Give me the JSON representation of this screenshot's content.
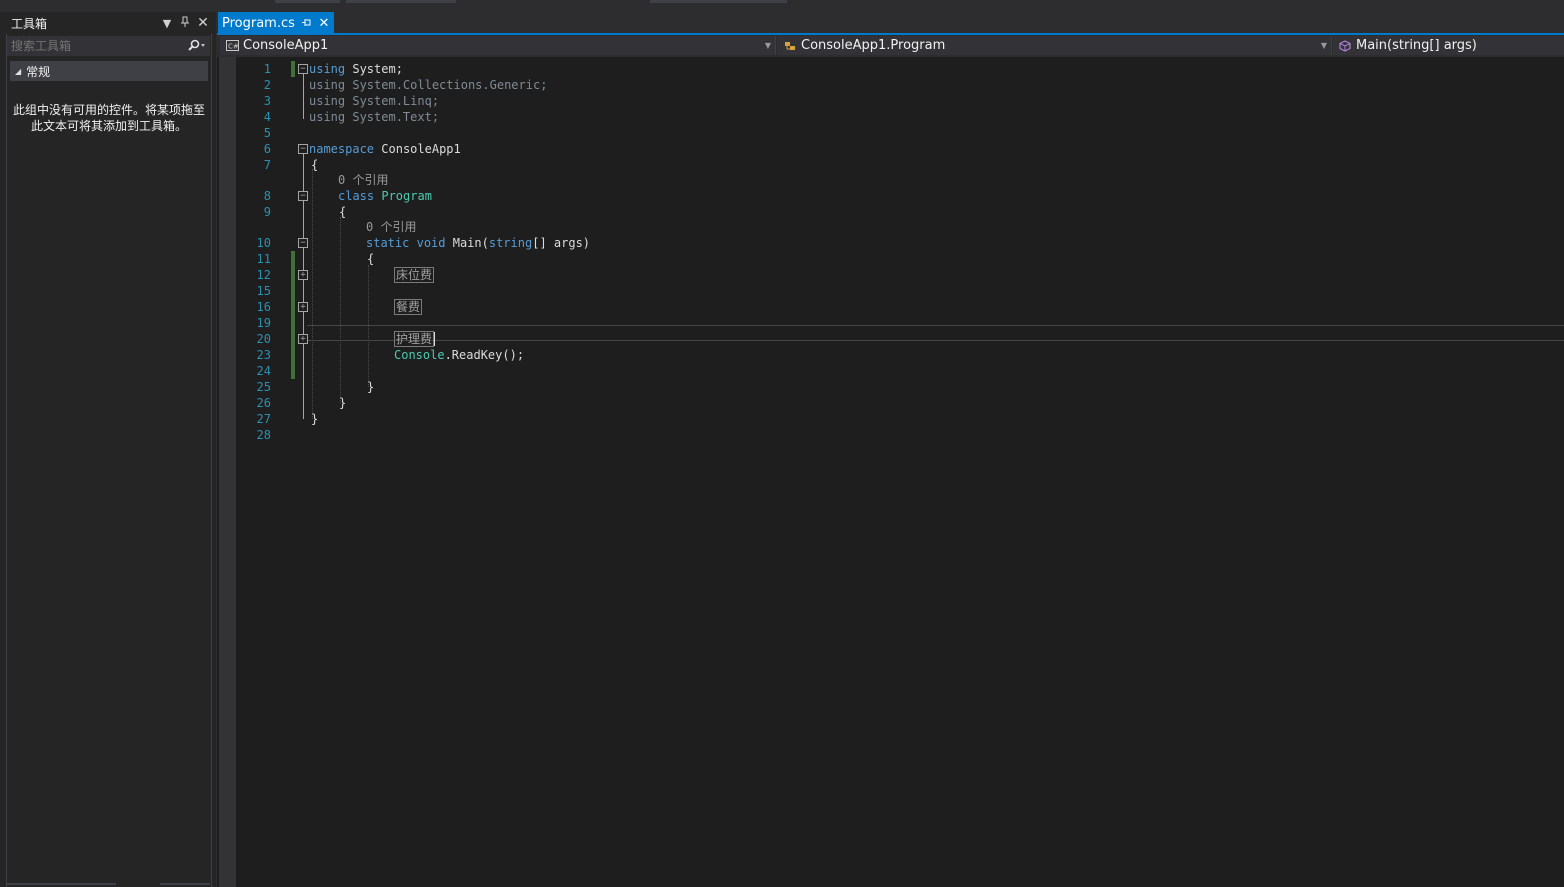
{
  "toolbox": {
    "title": "工具箱",
    "search_placeholder": "搜索工具箱",
    "group_label": "常规",
    "empty_message": "此组中没有可用的控件。将某项拖至此文本可将其添加到工具箱。"
  },
  "editor": {
    "tab_name": "Program.cs",
    "nav": {
      "project": "ConsoleApp1",
      "class": "ConsoleApp1.Program",
      "member": "Main(string[] args)"
    },
    "code": {
      "ln": {
        "l1": "1",
        "l2": "2",
        "l3": "3",
        "l4": "4",
        "l5": "5",
        "l6": "6",
        "l7": "7",
        "l8": "8",
        "l9": "9",
        "l10": "10",
        "l11": "11",
        "l12": "12",
        "l15": "15",
        "l16": "16",
        "l19": "19",
        "l20": "20",
        "l23": "23",
        "l24": "24",
        "l25": "25",
        "l26": "26",
        "l27": "27",
        "l28": "28"
      },
      "kw_using": "using",
      "ns_system": "System;",
      "ns_collections": "System.Collections.Generic;",
      "ns_linq": "System.Linq;",
      "ns_text": "System.Text;",
      "kw_namespace": "namespace",
      "namespace_name": "ConsoleApp1",
      "brace_open": "{",
      "brace_close": "}",
      "lens_refs": "0 个引用",
      "kw_class": "class",
      "class_name": "Program",
      "kw_static": "static",
      "kw_void": "void",
      "main_name": "Main(",
      "kw_string": "string",
      "main_params": "[] args)",
      "region_bed": "床位费",
      "region_meal": "餐费",
      "region_care": "护理费",
      "console_type": "Console",
      "console_call": ".ReadKey();"
    }
  }
}
